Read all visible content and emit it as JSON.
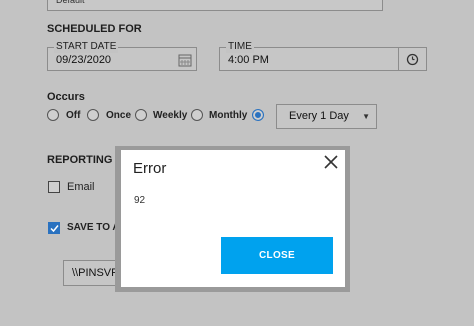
{
  "top_field": {
    "value": "Default"
  },
  "scheduled": {
    "heading": "SCHEDULED FOR",
    "start_date": {
      "label": "START DATE",
      "value": "09/23/2020"
    },
    "time": {
      "label": "TIME",
      "value": "4:00 PM"
    }
  },
  "occurs": {
    "heading": "Occurs",
    "options": [
      {
        "label": "Off",
        "checked": false
      },
      {
        "label": "Once",
        "checked": false
      },
      {
        "label": "Weekly",
        "checked": false
      },
      {
        "label": "Monthly",
        "checked": false
      },
      {
        "label": "",
        "checked": true
      }
    ],
    "interval": {
      "value": "Every 1 Day"
    }
  },
  "reporting": {
    "heading": "REPORTING ME",
    "email": {
      "label": "Email",
      "checked": false
    },
    "save": {
      "label": "SAVE TO A",
      "checked": true
    },
    "path_value": "\\\\PINSVR"
  },
  "modal": {
    "title": "Error",
    "message": "92",
    "close_button": "CLOSE"
  },
  "colors": {
    "accent": "#00a2ee",
    "checked": "#2a72c0",
    "overlay": "#c3c3c3"
  }
}
